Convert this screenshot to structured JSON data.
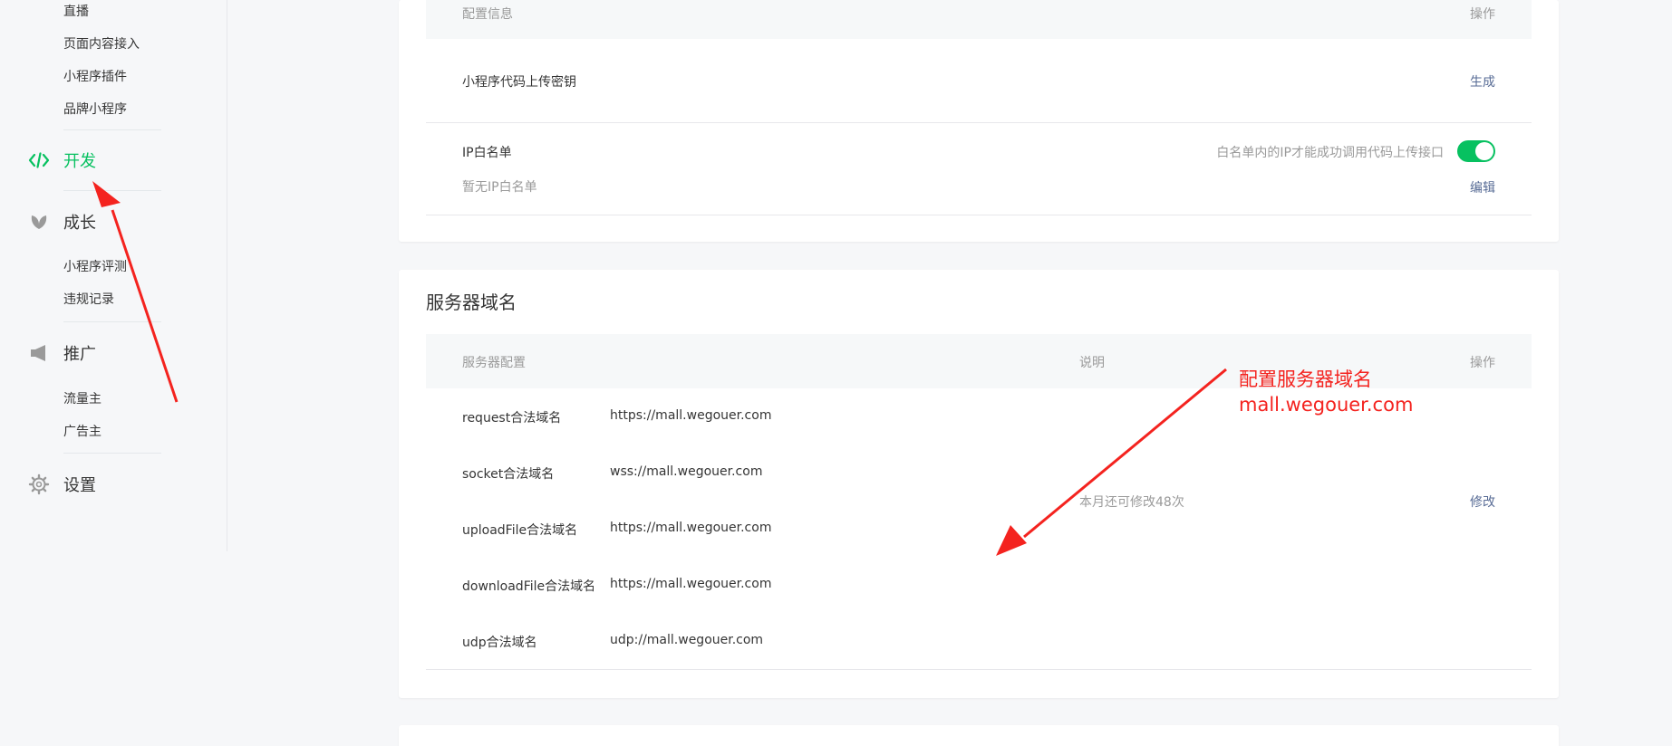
{
  "sidebar": {
    "top_items": [
      "直播",
      "页面内容接入",
      "小程序插件",
      "品牌小程序"
    ],
    "dev": {
      "label": "开发",
      "icon": "code-icon",
      "color": "#07c160"
    },
    "growth": {
      "label": "成长",
      "icon": "leaf-icon",
      "items": [
        "小程序评测",
        "违规记录"
      ]
    },
    "promo": {
      "label": "推广",
      "icon": "megaphone-icon",
      "items": [
        "流量主",
        "广告主"
      ]
    },
    "settings": {
      "label": "设置",
      "icon": "gear-icon"
    }
  },
  "config_card": {
    "header": {
      "col_info": "配置信息",
      "col_action": "操作"
    },
    "upload_key": {
      "label": "小程序代码上传密钥",
      "action": "生成"
    },
    "ip_whitelist": {
      "label": "IP白名单",
      "empty_text": "暂无IP白名单",
      "toggle_hint": "白名单内的IP才能成功调用代码上传接口",
      "toggle_on": true,
      "action": "编辑"
    }
  },
  "server_card": {
    "title": "服务器域名",
    "header": {
      "col_config": "服务器配置",
      "col_desc": "说明",
      "col_action": "操作"
    },
    "rows": [
      {
        "name": "request合法域名",
        "value": "https://mall.wegouer.com"
      },
      {
        "name": "socket合法域名",
        "value": "wss://mall.wegouer.com"
      },
      {
        "name": "uploadFile合法域名",
        "value": "https://mall.wegouer.com"
      },
      {
        "name": "downloadFile合法域名",
        "value": "https://mall.wegouer.com"
      },
      {
        "name": "udp合法域名",
        "value": "udp://mall.wegouer.com"
      }
    ],
    "desc": "本月还可修改48次",
    "action": "修改"
  },
  "annotation": {
    "line1": "配置服务器域名",
    "line2": "mall.wegouer.com",
    "color": "#f4231f"
  },
  "colors": {
    "accent": "#07c160",
    "link": "#576b95",
    "muted": "#9a9a9a",
    "text": "#353535"
  }
}
